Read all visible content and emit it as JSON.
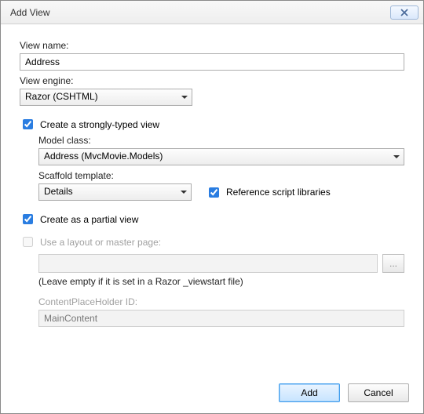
{
  "window": {
    "title": "Add View"
  },
  "viewName": {
    "label": "View name:",
    "value": "Address"
  },
  "viewEngine": {
    "label": "View engine:",
    "value": "Razor (CSHTML)"
  },
  "stronglyTyped": {
    "label": "Create a strongly-typed view",
    "checked": true,
    "modelClass": {
      "label": "Model class:",
      "value": "Address (MvcMovie.Models)"
    },
    "scaffold": {
      "label": "Scaffold template:",
      "value": "Details"
    },
    "refScripts": {
      "label": "Reference script libraries",
      "checked": true
    }
  },
  "partialView": {
    "label": "Create as a partial view",
    "checked": true
  },
  "layout": {
    "label": "Use a layout or master page:",
    "checked": false,
    "value": "",
    "browse": "...",
    "hint": "(Leave empty if it is set in a Razor _viewstart file)",
    "placeholder": {
      "label": "ContentPlaceHolder ID:",
      "value": "MainContent"
    }
  },
  "buttons": {
    "add": "Add",
    "cancel": "Cancel"
  }
}
